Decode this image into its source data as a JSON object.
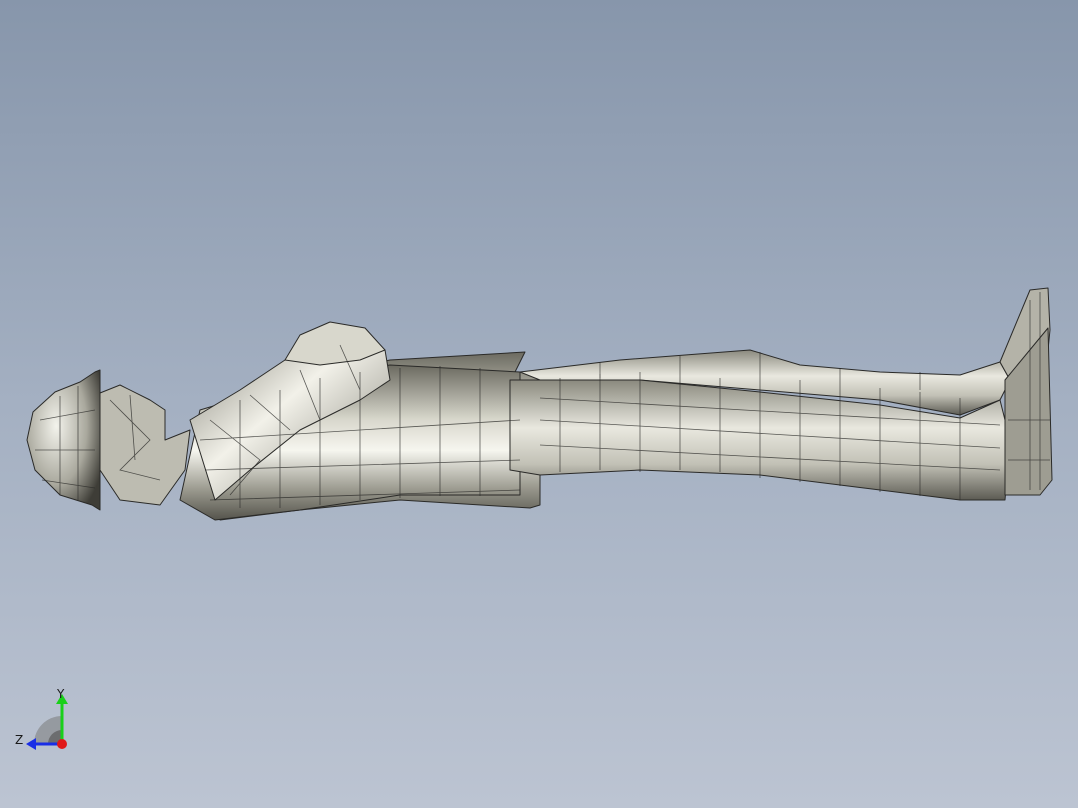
{
  "viewport": {
    "background_top": "#8796ab",
    "background_bottom": "#bcc4d2",
    "model": {
      "name": "worker-lying-mesh-model",
      "mesh_style": "shaded-with-edges",
      "surface_color": "#c9c8bc",
      "edge_color": "#2a2a28"
    },
    "triad": {
      "y_label": "Y",
      "z_label": "Z",
      "y_color": "#19d019",
      "z_color": "#1a2ee6",
      "x_color": "#e01818"
    }
  }
}
